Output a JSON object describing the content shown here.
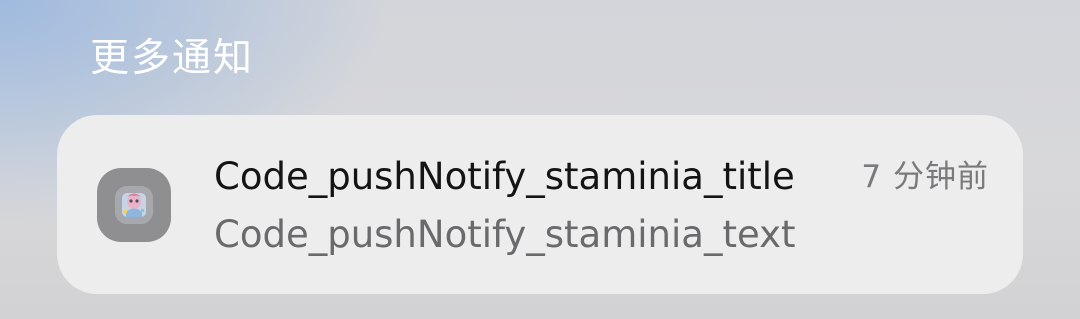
{
  "section": {
    "header": "更多通知"
  },
  "notification": {
    "app_icon": "app-game-icon",
    "title": "Code_pushNotify_staminia_title",
    "text": "Code_pushNotify_staminia_text",
    "time": "7 分钟前"
  },
  "colors": {
    "card_background": "#ededee",
    "title_text": "#141414",
    "body_text": "#6a6a6c",
    "header_text": "#ffffff"
  }
}
